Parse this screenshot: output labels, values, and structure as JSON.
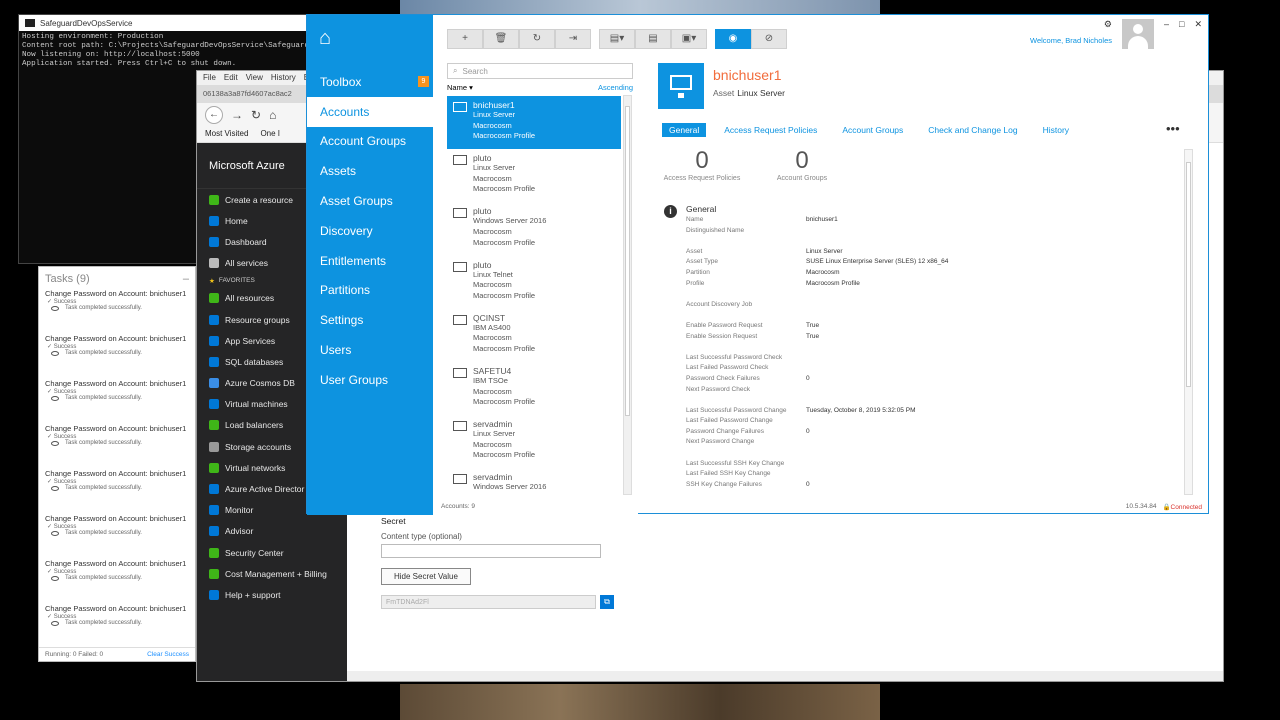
{
  "console": {
    "title": "SafeguardDevOpsService",
    "lines": "Hosting environment: Production\nContent root path: C:\\Projects\\SafeguardDevOpsService\\SafeguardD\nNow listening on: http://localhost:5000\nApplication started. Press Ctrl+C to shut down."
  },
  "browser": {
    "menu": [
      "File",
      "Edit",
      "View",
      "History",
      "B"
    ],
    "tab": "06138a3a87fd4607ac8ac2",
    "bookmarks": [
      "Most Visited",
      "One I"
    ],
    "azure": {
      "brand": "Microsoft Azure",
      "items": [
        {
          "label": "Create a resource",
          "color": "#3fb618"
        },
        {
          "label": "Home",
          "color": "#0078d7"
        },
        {
          "label": "Dashboard",
          "color": "#0078d7"
        },
        {
          "label": "All services",
          "color": "#bbbbbb"
        }
      ],
      "favorites_label": "FAVORITES",
      "favorites": [
        {
          "label": "All resources",
          "color": "#3fb618"
        },
        {
          "label": "Resource groups",
          "color": "#0078d7"
        },
        {
          "label": "App Services",
          "color": "#0078d7"
        },
        {
          "label": "SQL databases",
          "color": "#0078d7"
        },
        {
          "label": "Azure Cosmos DB",
          "color": "#3a8ee6"
        },
        {
          "label": "Virtual machines",
          "color": "#0078d7"
        },
        {
          "label": "Load balancers",
          "color": "#3fb618"
        },
        {
          "label": "Storage accounts",
          "color": "#999999"
        },
        {
          "label": "Virtual networks",
          "color": "#3fb618"
        },
        {
          "label": "Azure Active Director",
          "color": "#0078d7"
        },
        {
          "label": "Monitor",
          "color": "#0078d7"
        },
        {
          "label": "Advisor",
          "color": "#0078d7"
        },
        {
          "label": "Security Center",
          "color": "#3fb618"
        },
        {
          "label": "Cost Management + Billing",
          "color": "#3fb618"
        },
        {
          "label": "Help + support",
          "color": "#0078d7"
        }
      ]
    },
    "secret": {
      "label": "Secret",
      "content_type_label": "Content type (optional)",
      "hide_button": "Hide Secret Value",
      "value": "FmTDNAd2Fl"
    }
  },
  "tasks": {
    "title": "Tasks (9)",
    "items": [
      {
        "title": "Change Password on Account: bnichuser1",
        "status": "Success",
        "message": "Task completed successfully."
      },
      {
        "title": "Change Password on Account: bnichuser1",
        "status": "Success",
        "message": "Task completed successfully."
      },
      {
        "title": "Change Password on Account: bnichuser1",
        "status": "Success",
        "message": "Task completed successfully."
      },
      {
        "title": "Change Password on Account: bnichuser1",
        "status": "Success",
        "message": "Task completed successfully."
      },
      {
        "title": "Change Password on Account: bnichuser1",
        "status": "Success",
        "message": "Task completed successfully."
      },
      {
        "title": "Change Password on Account: bnichuser1",
        "status": "Success",
        "message": "Task completed successfully."
      },
      {
        "title": "Change Password on Account: bnichuser1",
        "status": "Success",
        "message": "Task completed successfully."
      },
      {
        "title": "Change Password on Account: bnichuser1",
        "status": "Success",
        "message": "Task completed successfully."
      }
    ],
    "footer_counts": "Running: 0  Failed: 0",
    "clear": "Clear Success"
  },
  "safeguard": {
    "nav": [
      {
        "label": "Toolbox",
        "badge": "9",
        "active": false
      },
      {
        "label": "Accounts",
        "badge": "",
        "active": true
      },
      {
        "label": "Account Groups",
        "badge": "",
        "active": false
      },
      {
        "label": "Assets",
        "badge": "",
        "active": false
      },
      {
        "label": "Asset Groups",
        "badge": "",
        "active": false
      },
      {
        "label": "Discovery",
        "badge": "",
        "active": false
      },
      {
        "label": "Entitlements",
        "badge": "",
        "active": false
      },
      {
        "label": "Partitions",
        "badge": "",
        "active": false
      },
      {
        "label": "Settings",
        "badge": "",
        "active": false
      },
      {
        "label": "Users",
        "badge": "",
        "active": false
      },
      {
        "label": "User Groups",
        "badge": "",
        "active": false
      }
    ],
    "toolbar": [
      {
        "name": "add",
        "glyph": "+"
      },
      {
        "name": "delete",
        "glyph": "🗑"
      },
      {
        "name": "refresh",
        "glyph": "↻"
      },
      {
        "name": "export",
        "glyph": "⇥"
      },
      {
        "name": "gap",
        "glyph": ""
      },
      {
        "name": "view-menu",
        "glyph": "▤▾"
      },
      {
        "name": "details",
        "glyph": "▤"
      },
      {
        "name": "actions-menu",
        "glyph": "▣▾"
      },
      {
        "name": "gap",
        "glyph": ""
      },
      {
        "name": "show",
        "glyph": "◉"
      },
      {
        "name": "hide",
        "glyph": "⊘"
      }
    ],
    "search_placeholder": "Search",
    "sort_label": "Name",
    "sort_order": "Ascending",
    "accounts": [
      {
        "name": "bnichuser1",
        "lines": [
          "Linux Server",
          "Macrocosm",
          "Macrocosm Profile"
        ]
      },
      {
        "name": "pluto",
        "lines": [
          "Linux Server",
          "Macrocosm",
          "Macrocosm Profile"
        ]
      },
      {
        "name": "pluto",
        "lines": [
          "Windows Server 2016",
          "Macrocosm",
          "Macrocosm Profile"
        ]
      },
      {
        "name": "pluto",
        "lines": [
          "Linux Telnet",
          "Macrocosm",
          "Macrocosm Profile"
        ]
      },
      {
        "name": "QCINST",
        "lines": [
          "IBM AS400",
          "Macrocosm",
          "Macrocosm Profile"
        ]
      },
      {
        "name": "SAFETU4",
        "lines": [
          "IBM TSOe",
          "Macrocosm",
          "Macrocosm Profile"
        ]
      },
      {
        "name": "servadmin",
        "lines": [
          "Linux Server",
          "Macrocosm",
          "Macrocosm Profile"
        ]
      },
      {
        "name": "servadmin",
        "lines": [
          "Windows Server 2016"
        ]
      }
    ],
    "accounts_count": "Accounts: 9",
    "welcome": "Welcome, Brad Nicholes",
    "detail": {
      "name": "bnichuser1",
      "asset_label": "Asset",
      "asset_value": "Linux Server",
      "tabs": [
        "General",
        "Access Request Policies",
        "Account Groups",
        "Check and Change Log",
        "History"
      ],
      "counts": [
        {
          "value": "0",
          "label": "Access Request Policies"
        },
        {
          "value": "0",
          "label": "Account Groups"
        }
      ],
      "section_title": "General",
      "properties": [
        {
          "k": "Name",
          "v": "bnichuser1"
        },
        {
          "k": "Distinguished Name",
          "v": ""
        },
        {
          "k": "",
          "v": ""
        },
        {
          "k": "Asset",
          "v": "Linux Server"
        },
        {
          "k": "Asset Type",
          "v": "SUSE Linux Enterprise Server (SLES) 12 x86_64"
        },
        {
          "k": "Partition",
          "v": "Macrocosm"
        },
        {
          "k": "Profile",
          "v": "Macrocosm Profile"
        },
        {
          "k": "",
          "v": ""
        },
        {
          "k": "Account Discovery Job",
          "v": ""
        },
        {
          "k": "",
          "v": ""
        },
        {
          "k": "Enable Password Request",
          "v": "True"
        },
        {
          "k": "Enable Session Request",
          "v": "True"
        },
        {
          "k": "",
          "v": ""
        },
        {
          "k": "Last Successful Password Check",
          "v": ""
        },
        {
          "k": "Last Failed Password Check",
          "v": ""
        },
        {
          "k": "Password Check Failures",
          "v": "0"
        },
        {
          "k": "Next Password Check",
          "v": ""
        },
        {
          "k": "",
          "v": ""
        },
        {
          "k": "Last Successful Password Change",
          "v": "Tuesday, October 8, 2019 5:32:05 PM"
        },
        {
          "k": "Last Failed Password Change",
          "v": ""
        },
        {
          "k": "Password Change Failures",
          "v": "0"
        },
        {
          "k": "Next Password Change",
          "v": ""
        },
        {
          "k": "",
          "v": ""
        },
        {
          "k": "Last Successful SSH Key Change",
          "v": ""
        },
        {
          "k": "Last Failed SSH Key Change",
          "v": ""
        },
        {
          "k": "SSH Key Change Failures",
          "v": "0"
        }
      ]
    },
    "status_ip": "10.5.34.84",
    "status_conn": "Connected"
  }
}
